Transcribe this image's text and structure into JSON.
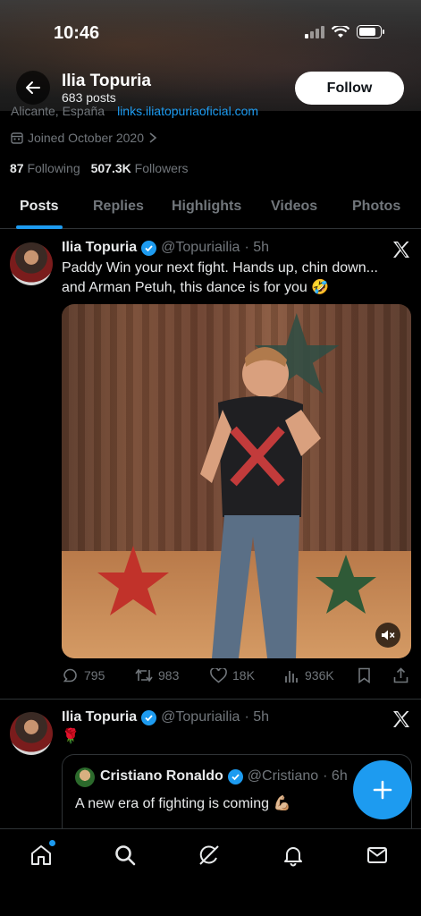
{
  "status_bar": {
    "time": "10:46"
  },
  "header": {
    "name": "Ilia Topuria",
    "posts_count": "683 posts",
    "follow_label": "Follow"
  },
  "profile": {
    "location_partial": "Alicante, España",
    "link_partial": "links.iliatopuriaoficial.com",
    "joined": "Joined October 2020",
    "following_count": "87",
    "following_label": "Following",
    "followers_count": "507.3K",
    "followers_label": "Followers"
  },
  "tabs": [
    {
      "label": "Posts",
      "active": true
    },
    {
      "label": "Replies"
    },
    {
      "label": "Highlights"
    },
    {
      "label": "Videos"
    },
    {
      "label": "Photos"
    }
  ],
  "posts": [
    {
      "name": "Ilia Topuria",
      "handle": "@Topuriailia",
      "time": "· 5h",
      "text": "Paddy Win your next fight. Hands up, chin down... and Arman Petuh, this dance is for you 🤣",
      "actions": {
        "replies": "795",
        "reposts": "983",
        "likes": "18K",
        "views": "936K"
      }
    },
    {
      "name": "Ilia Topuria",
      "handle": "@Topuriailia",
      "time": "· 5h",
      "text": "🌹",
      "quote": {
        "name": "Cristiano Ronaldo",
        "handle": "@Cristiano",
        "time": "· 6h",
        "text": "A new era of fighting is coming 💪🏼"
      }
    }
  ],
  "colors": {
    "accent": "#1d9bf0",
    "background": "#000000",
    "muted": "#71767b"
  },
  "icons": [
    "back-arrow-icon",
    "x-logo-icon",
    "verified-badge-icon",
    "reply-icon",
    "repost-icon",
    "like-icon",
    "views-icon",
    "bookmark-icon",
    "share-icon",
    "mute-icon",
    "compose-plus-icon",
    "home-icon",
    "search-icon",
    "grok-icon",
    "notifications-icon",
    "messages-icon"
  ]
}
